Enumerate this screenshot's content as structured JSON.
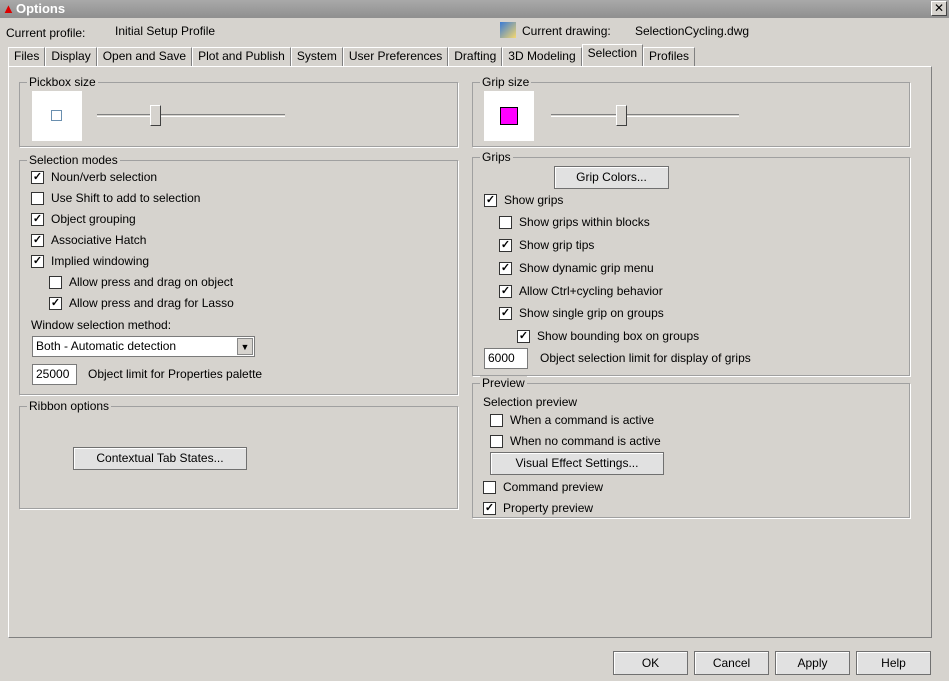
{
  "window": {
    "title": "Options",
    "close": "✕"
  },
  "header": {
    "profile_label": "Current profile:",
    "profile_value": "Initial Setup Profile",
    "drawing_label": "Current drawing:",
    "drawing_value": "SelectionCycling.dwg"
  },
  "tabs": [
    {
      "label": "Files"
    },
    {
      "label": "Display"
    },
    {
      "label": "Open and Save"
    },
    {
      "label": "Plot and Publish"
    },
    {
      "label": "System"
    },
    {
      "label": "User Preferences"
    },
    {
      "label": "Drafting"
    },
    {
      "label": "3D Modeling"
    },
    {
      "label": "Selection",
      "active": true
    },
    {
      "label": "Profiles"
    }
  ],
  "pickbox": {
    "title": "Pickbox size",
    "level": 0.31
  },
  "grip_size": {
    "title": "Grip size",
    "level": 0.37,
    "color": "#ff00ff"
  },
  "selection_modes": {
    "title": "Selection modes",
    "items": [
      {
        "label": "Noun/verb selection",
        "checked": true
      },
      {
        "label": "Use Shift to add to selection",
        "checked": false
      },
      {
        "label": "Object grouping",
        "checked": true
      },
      {
        "label": "Associative Hatch",
        "checked": true
      },
      {
        "label": "Implied windowing",
        "checked": true
      },
      {
        "label": "Allow press and drag on object",
        "checked": false
      },
      {
        "label": "Allow press and drag for Lasso",
        "checked": true
      }
    ],
    "window_method_label": "Window selection method:",
    "window_method_value": "Both - Automatic detection",
    "object_limit_value": "25000",
    "object_limit_label": "Object limit for Properties palette"
  },
  "ribbon": {
    "title": "Ribbon options",
    "button": "Contextual Tab States..."
  },
  "grips": {
    "title": "Grips",
    "colors_button": "Grip Colors...",
    "items": [
      {
        "label": "Show grips",
        "checked": true
      },
      {
        "label": "Show grips within blocks",
        "checked": false
      },
      {
        "label": "Show grip tips",
        "checked": true
      },
      {
        "label": "Show dynamic grip menu",
        "checked": true
      },
      {
        "label": "Allow Ctrl+cycling behavior",
        "checked": true
      },
      {
        "label": "Show single grip on groups",
        "checked": true
      },
      {
        "label": "Show bounding box on groups",
        "checked": true
      }
    ],
    "limit_value": "6000",
    "limit_label": "Object selection limit for display of grips"
  },
  "preview": {
    "title": "Preview",
    "sub": "Selection preview",
    "items": [
      {
        "label": "When a command is active",
        "checked": false
      },
      {
        "label": "When no command is active",
        "checked": false
      }
    ],
    "visual_button": "Visual Effect Settings...",
    "command_preview": {
      "label": "Command preview",
      "checked": false
    },
    "property_preview": {
      "label": "Property preview",
      "checked": true
    }
  },
  "footer": {
    "ok": "OK",
    "cancel": "Cancel",
    "apply": "Apply",
    "help": "Help"
  }
}
